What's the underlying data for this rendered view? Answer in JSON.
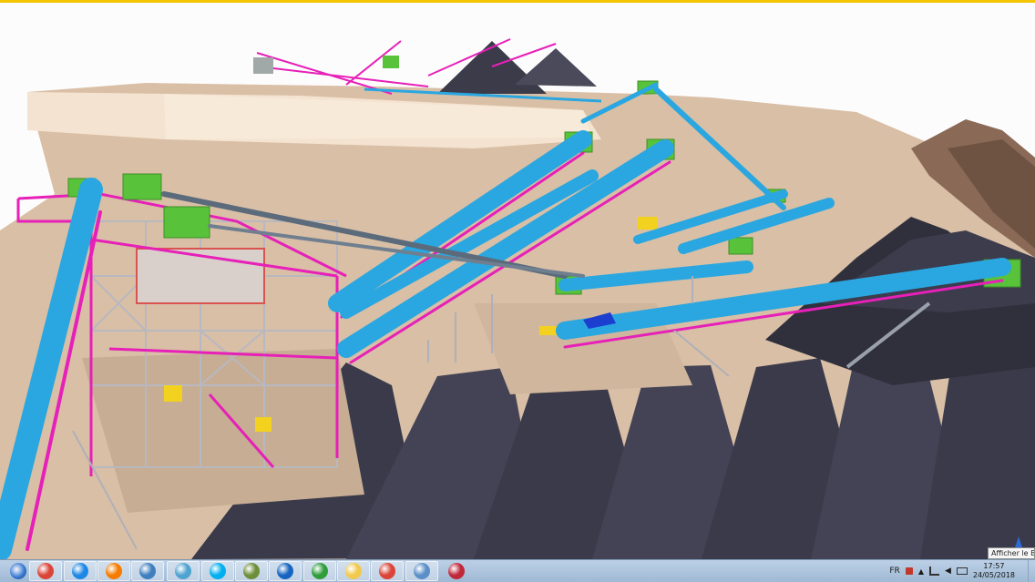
{
  "colors": {
    "top_accent": "#f2c500",
    "sky": "#fdfcfd",
    "ground": "#d8bea4",
    "structure_magenta": "#e620b8",
    "conveyor_blue": "#2aa7e0",
    "motor_green": "#58c23a",
    "stockpile": "#3a3a48",
    "taskbar": "#a9c1da"
  },
  "taskbar": {
    "start_icon": "windows-start-icon",
    "pinned": [
      {
        "icon": "chrome-icon",
        "color": "#db4437"
      },
      {
        "icon": "internet-explorer-icon",
        "color": "#1e88e5"
      },
      {
        "icon": "media-player-icon",
        "color": "#f57c00"
      },
      {
        "icon": "globe-icon",
        "color": "#3f7fbf"
      },
      {
        "icon": "cloud-icon",
        "color": "#4fa3d1"
      },
      {
        "icon": "skype-icon",
        "color": "#00aff0"
      },
      {
        "icon": "tool-app-icon",
        "color": "#6d8f3a"
      },
      {
        "icon": "outlook-icon",
        "color": "#1565c0"
      },
      {
        "icon": "camtasia-icon",
        "color": "#2e9d3a"
      },
      {
        "icon": "file-explorer-icon",
        "color": "#f2c94c"
      },
      {
        "icon": "chrome-icon",
        "color": "#db4437"
      },
      {
        "icon": "image-viewer-icon",
        "color": "#5a8fc7"
      },
      {
        "icon": "tekla-structures-icon",
        "color": "#c0283a"
      }
    ],
    "tray": {
      "language": "FR",
      "time": "17:57",
      "date": "24/05/2018"
    },
    "tooltip": "Afficher le Bureau"
  }
}
